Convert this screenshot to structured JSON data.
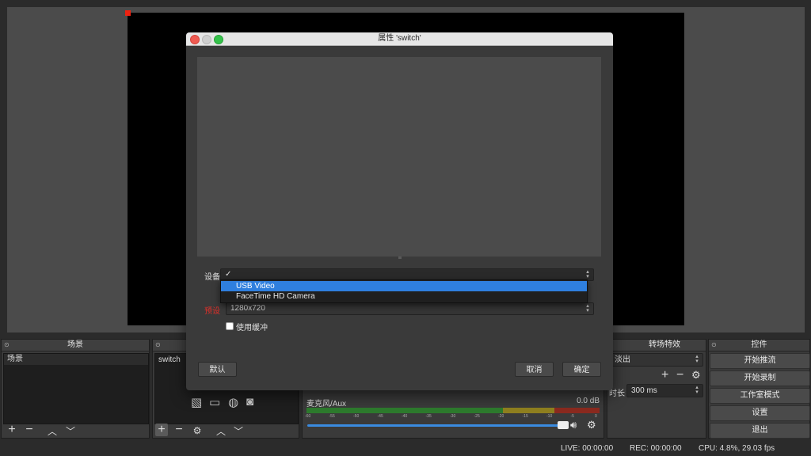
{
  "dialog": {
    "title": "属性 'switch'",
    "device_label": "设备",
    "device_value": "✓",
    "device_options": [
      "USB Video",
      "FaceTime HD Camera"
    ],
    "selected_option": "USB Video",
    "preset_label": "预设",
    "preset_value": "1280x720",
    "buffer_label": "使用缓冲",
    "buffer_checked": false,
    "defaults_button": "默认",
    "cancel_button": "取消",
    "ok_button": "确定"
  },
  "scenes": {
    "title": "场景",
    "items": [
      "场景"
    ]
  },
  "sources": {
    "items": [
      "switch"
    ]
  },
  "mixer": {
    "channel_name": "麦克风/Aux",
    "level": "0.0 dB",
    "ticks": [
      "-60",
      "-55",
      "-50",
      "-45",
      "-40",
      "-35",
      "-30",
      "-25",
      "-20",
      "-15",
      "-10",
      "-5",
      "0"
    ]
  },
  "transitions": {
    "title": "转场特效",
    "selected": "淡出",
    "duration_label": "时长",
    "duration_value": "300 ms"
  },
  "controls": {
    "title": "控件",
    "buttons": [
      "开始推流",
      "开始录制",
      "工作室模式",
      "设置",
      "退出"
    ]
  },
  "status": {
    "live": "LIVE: 00:00:00",
    "rec": "REC: 00:00:00",
    "cpu": "CPU: 4.8%, 29.03 fps"
  },
  "colors": {
    "accent": "#2f7fde",
    "preset_label": "#e0302a",
    "meter_green": "#3a9a3a",
    "meter_yellow": "#b9a32a",
    "meter_red": "#b83a2a"
  }
}
